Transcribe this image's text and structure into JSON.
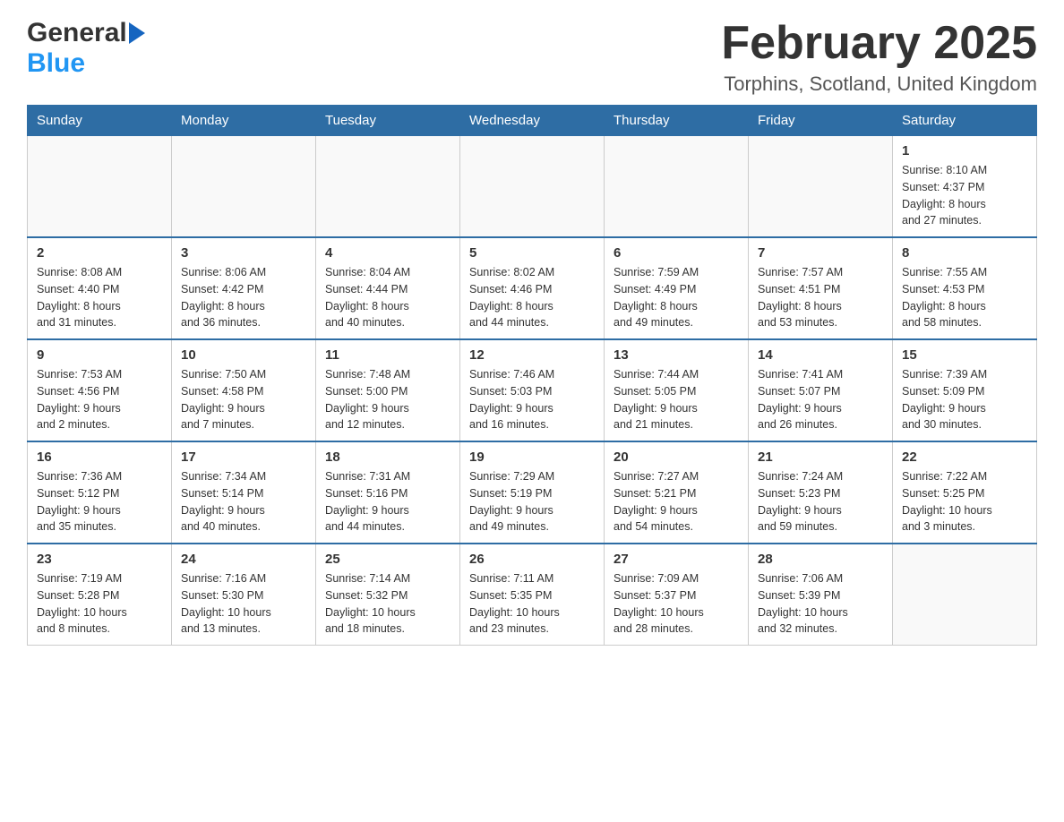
{
  "header": {
    "month_title": "February 2025",
    "location": "Torphins, Scotland, United Kingdom",
    "logo_general": "General",
    "logo_blue": "Blue"
  },
  "weekdays": [
    "Sunday",
    "Monday",
    "Tuesday",
    "Wednesday",
    "Thursday",
    "Friday",
    "Saturday"
  ],
  "weeks": [
    [
      {
        "day": "",
        "info": ""
      },
      {
        "day": "",
        "info": ""
      },
      {
        "day": "",
        "info": ""
      },
      {
        "day": "",
        "info": ""
      },
      {
        "day": "",
        "info": ""
      },
      {
        "day": "",
        "info": ""
      },
      {
        "day": "1",
        "info": "Sunrise: 8:10 AM\nSunset: 4:37 PM\nDaylight: 8 hours\nand 27 minutes."
      }
    ],
    [
      {
        "day": "2",
        "info": "Sunrise: 8:08 AM\nSunset: 4:40 PM\nDaylight: 8 hours\nand 31 minutes."
      },
      {
        "day": "3",
        "info": "Sunrise: 8:06 AM\nSunset: 4:42 PM\nDaylight: 8 hours\nand 36 minutes."
      },
      {
        "day": "4",
        "info": "Sunrise: 8:04 AM\nSunset: 4:44 PM\nDaylight: 8 hours\nand 40 minutes."
      },
      {
        "day": "5",
        "info": "Sunrise: 8:02 AM\nSunset: 4:46 PM\nDaylight: 8 hours\nand 44 minutes."
      },
      {
        "day": "6",
        "info": "Sunrise: 7:59 AM\nSunset: 4:49 PM\nDaylight: 8 hours\nand 49 minutes."
      },
      {
        "day": "7",
        "info": "Sunrise: 7:57 AM\nSunset: 4:51 PM\nDaylight: 8 hours\nand 53 minutes."
      },
      {
        "day": "8",
        "info": "Sunrise: 7:55 AM\nSunset: 4:53 PM\nDaylight: 8 hours\nand 58 minutes."
      }
    ],
    [
      {
        "day": "9",
        "info": "Sunrise: 7:53 AM\nSunset: 4:56 PM\nDaylight: 9 hours\nand 2 minutes."
      },
      {
        "day": "10",
        "info": "Sunrise: 7:50 AM\nSunset: 4:58 PM\nDaylight: 9 hours\nand 7 minutes."
      },
      {
        "day": "11",
        "info": "Sunrise: 7:48 AM\nSunset: 5:00 PM\nDaylight: 9 hours\nand 12 minutes."
      },
      {
        "day": "12",
        "info": "Sunrise: 7:46 AM\nSunset: 5:03 PM\nDaylight: 9 hours\nand 16 minutes."
      },
      {
        "day": "13",
        "info": "Sunrise: 7:44 AM\nSunset: 5:05 PM\nDaylight: 9 hours\nand 21 minutes."
      },
      {
        "day": "14",
        "info": "Sunrise: 7:41 AM\nSunset: 5:07 PM\nDaylight: 9 hours\nand 26 minutes."
      },
      {
        "day": "15",
        "info": "Sunrise: 7:39 AM\nSunset: 5:09 PM\nDaylight: 9 hours\nand 30 minutes."
      }
    ],
    [
      {
        "day": "16",
        "info": "Sunrise: 7:36 AM\nSunset: 5:12 PM\nDaylight: 9 hours\nand 35 minutes."
      },
      {
        "day": "17",
        "info": "Sunrise: 7:34 AM\nSunset: 5:14 PM\nDaylight: 9 hours\nand 40 minutes."
      },
      {
        "day": "18",
        "info": "Sunrise: 7:31 AM\nSunset: 5:16 PM\nDaylight: 9 hours\nand 44 minutes."
      },
      {
        "day": "19",
        "info": "Sunrise: 7:29 AM\nSunset: 5:19 PM\nDaylight: 9 hours\nand 49 minutes."
      },
      {
        "day": "20",
        "info": "Sunrise: 7:27 AM\nSunset: 5:21 PM\nDaylight: 9 hours\nand 54 minutes."
      },
      {
        "day": "21",
        "info": "Sunrise: 7:24 AM\nSunset: 5:23 PM\nDaylight: 9 hours\nand 59 minutes."
      },
      {
        "day": "22",
        "info": "Sunrise: 7:22 AM\nSunset: 5:25 PM\nDaylight: 10 hours\nand 3 minutes."
      }
    ],
    [
      {
        "day": "23",
        "info": "Sunrise: 7:19 AM\nSunset: 5:28 PM\nDaylight: 10 hours\nand 8 minutes."
      },
      {
        "day": "24",
        "info": "Sunrise: 7:16 AM\nSunset: 5:30 PM\nDaylight: 10 hours\nand 13 minutes."
      },
      {
        "day": "25",
        "info": "Sunrise: 7:14 AM\nSunset: 5:32 PM\nDaylight: 10 hours\nand 18 minutes."
      },
      {
        "day": "26",
        "info": "Sunrise: 7:11 AM\nSunset: 5:35 PM\nDaylight: 10 hours\nand 23 minutes."
      },
      {
        "day": "27",
        "info": "Sunrise: 7:09 AM\nSunset: 5:37 PM\nDaylight: 10 hours\nand 28 minutes."
      },
      {
        "day": "28",
        "info": "Sunrise: 7:06 AM\nSunset: 5:39 PM\nDaylight: 10 hours\nand 32 minutes."
      },
      {
        "day": "",
        "info": ""
      }
    ]
  ]
}
